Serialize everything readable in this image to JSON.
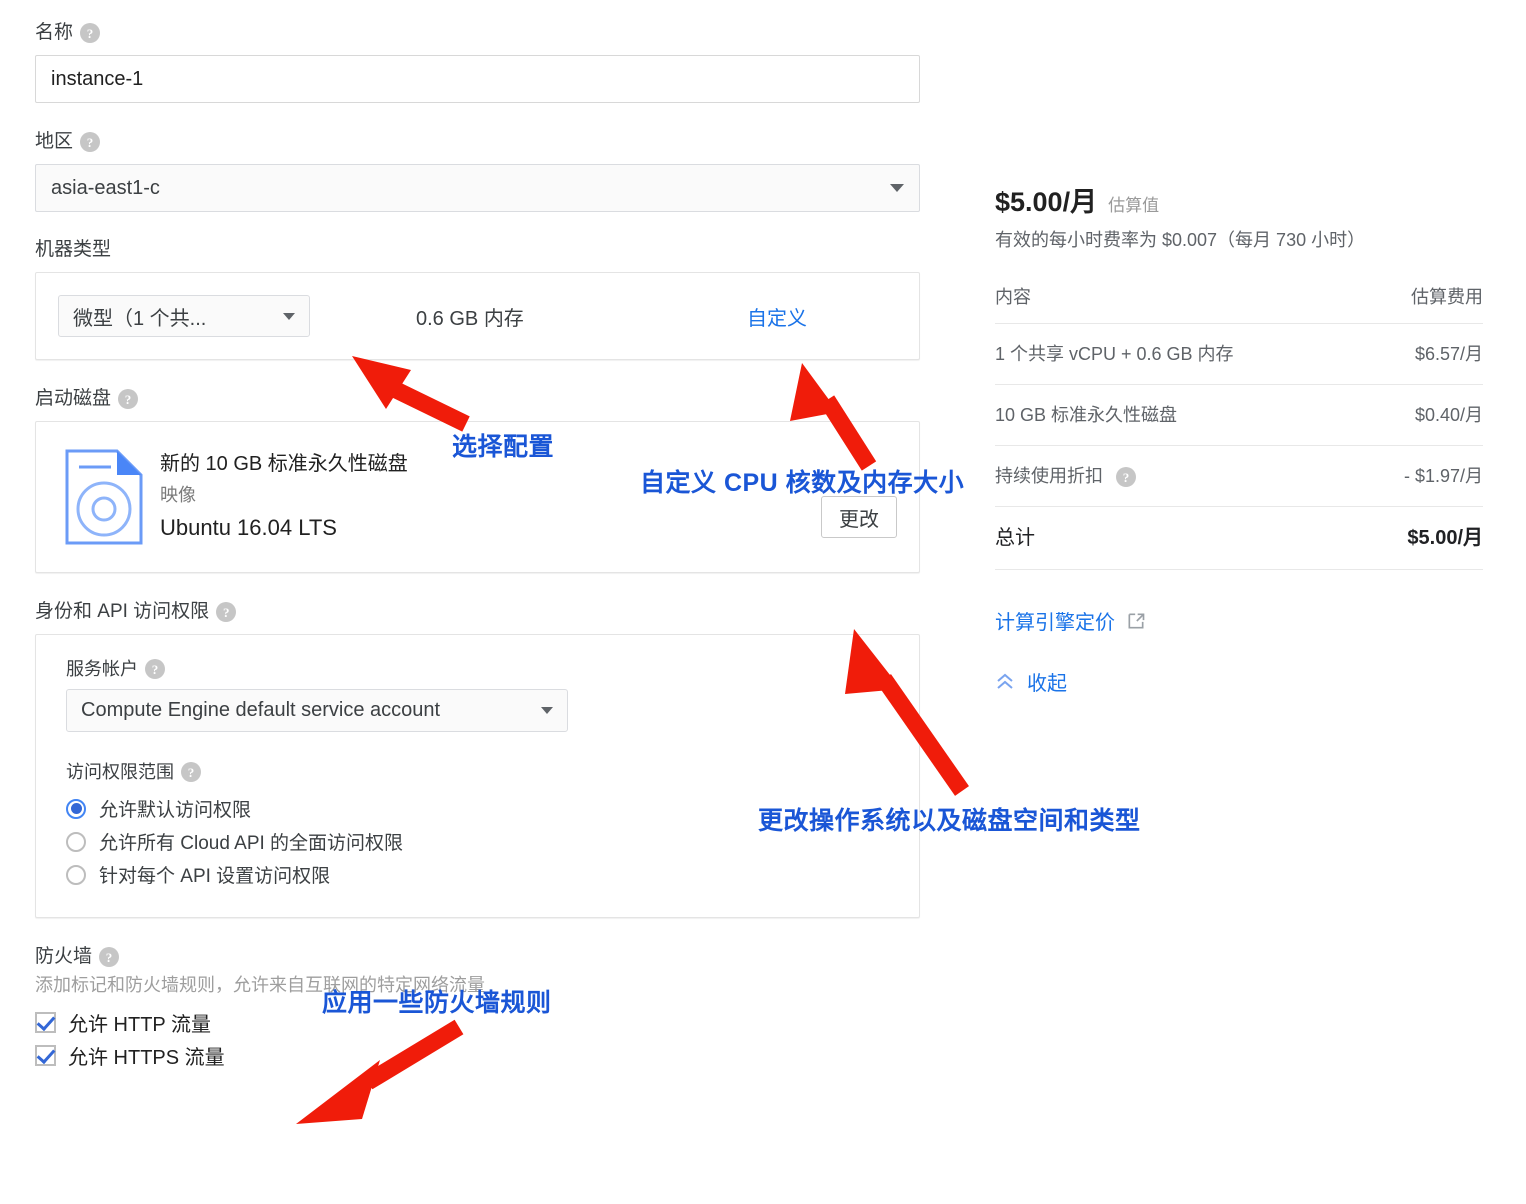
{
  "form": {
    "name": {
      "label": "名称",
      "help": "?",
      "value": "instance-1"
    },
    "region": {
      "label": "地区",
      "help": "?",
      "value": "asia-east1-c"
    },
    "machine_type": {
      "label": "机器类型",
      "selected": "微型（1 个共...",
      "memory": "0.6 GB 内存",
      "customize_link": "自定义"
    },
    "boot_disk": {
      "label": "启动磁盘",
      "help": "?",
      "icon": "disk-image-icon",
      "title": "新的 10 GB 标准永久性磁盘",
      "subtitle": "映像",
      "os": "Ubuntu 16.04 LTS",
      "change_button": "更改"
    },
    "identity": {
      "label": "身份和 API 访问权限",
      "help": "?",
      "service_account": {
        "label": "服务帐户",
        "help": "?",
        "value": "Compute Engine default service account"
      },
      "scopes": {
        "label": "访问权限范围",
        "help": "?",
        "options": [
          {
            "label": "允许默认访问权限",
            "selected": true
          },
          {
            "label": "允许所有 Cloud API 的全面访问权限",
            "selected": false
          },
          {
            "label": "针对每个 API 设置访问权限",
            "selected": false
          }
        ]
      }
    },
    "firewall": {
      "label": "防火墙",
      "help": "?",
      "description": "添加标记和防火墙规则，允许来自互联网的特定网络流量",
      "checkboxes": [
        {
          "label": "允许 HTTP 流量",
          "checked": true
        },
        {
          "label": "允许 HTTPS 流量",
          "checked": true
        }
      ]
    }
  },
  "price_panel": {
    "headline": "$5.00/月",
    "headline_note": "估算值",
    "rate_line": "有效的每小时费率为 $0.007（每月 730 小时）",
    "table": {
      "headers": [
        "内容",
        "估算费用"
      ],
      "rows": [
        {
          "item": "1 个共享 vCPU + 0.6 GB 内存",
          "cost": "$6.57/月",
          "help": false
        },
        {
          "item": "10 GB 标准永久性磁盘",
          "cost": "$0.40/月",
          "help": false
        },
        {
          "item": "持续使用折扣",
          "cost": "- $1.97/月",
          "help": true
        }
      ],
      "total": {
        "item": "总计",
        "cost": "$5.00/月"
      }
    },
    "pricing_link": "计算引擎定价",
    "collapse_link": "收起"
  },
  "annotations": [
    {
      "id": "select-config",
      "text": "选择配置"
    },
    {
      "id": "customize-cpu-memory",
      "text": "自定义 CPU 核数及内存大小"
    },
    {
      "id": "change-os-disk",
      "text": "更改操作系统以及磁盘空间和类型"
    },
    {
      "id": "apply-firewall-rules",
      "text": "应用一些防火墙规则"
    }
  ],
  "colors": {
    "annotation_blue": "#1a56d6",
    "arrow_red": "#f01c0a",
    "link_blue": "#1a73e8",
    "radio_blue": "#3367d6"
  }
}
